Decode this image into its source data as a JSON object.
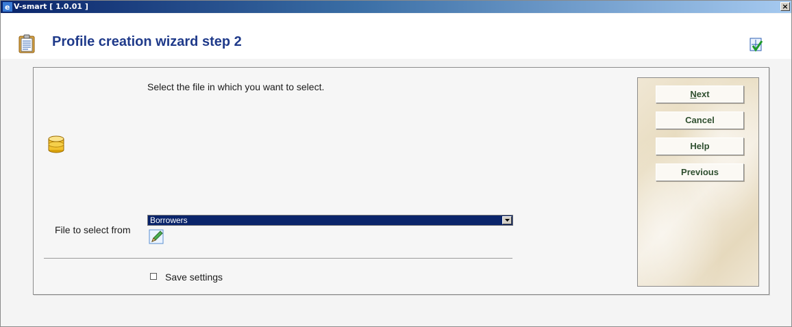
{
  "window": {
    "title": "V-smart [ 1.0.01 ]",
    "close_glyph": "×"
  },
  "header": {
    "title": "Profile creation wizard step 2",
    "left_icon": "clipboard-icon",
    "right_icon": "wizard-icon"
  },
  "form": {
    "instruction": "Select the file in which you want to select.",
    "file_label": "File to select from",
    "file_value": "Borrowers",
    "save_label": "Save settings",
    "save_checked": false
  },
  "buttons": {
    "next_first": "N",
    "next_rest": "ext",
    "cancel": "Cancel",
    "help": "Help",
    "previous": "Previous"
  },
  "colors": {
    "title": "#1f3a8a",
    "button_text": "#2f4f2f",
    "selection": "#0a246a"
  }
}
